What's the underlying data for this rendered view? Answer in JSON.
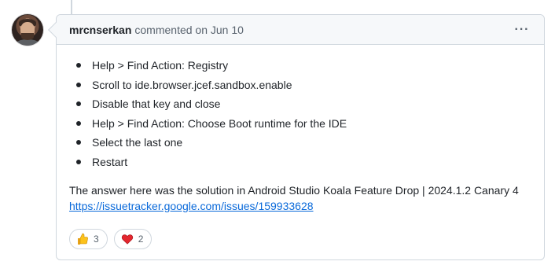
{
  "comment": {
    "author": "mrcnserkan",
    "action": "commented on Jun 10",
    "menu_glyph": "···",
    "list_items": [
      "Help > Find Action: Registry",
      "Scroll to ide.browser.jcef.sandbox.enable",
      "Disable that key and close",
      "Help > Find Action: Choose Boot runtime for the IDE",
      "Select the last one",
      "Restart"
    ],
    "paragraph": "The answer here was the solution in Android Studio Koala Feature Drop | 2024.1.2 Canary 4",
    "link_text": "https://issuetracker.google.com/issues/159933628"
  },
  "reactions": [
    {
      "icon": "thumbs-up-icon",
      "count": "3"
    },
    {
      "icon": "heart-icon",
      "count": "2"
    }
  ],
  "colors": {
    "border": "#d0d7de",
    "header_bg": "#f6f8fa",
    "link": "#0969da",
    "muted": "#59636e",
    "text": "#1f2328"
  }
}
